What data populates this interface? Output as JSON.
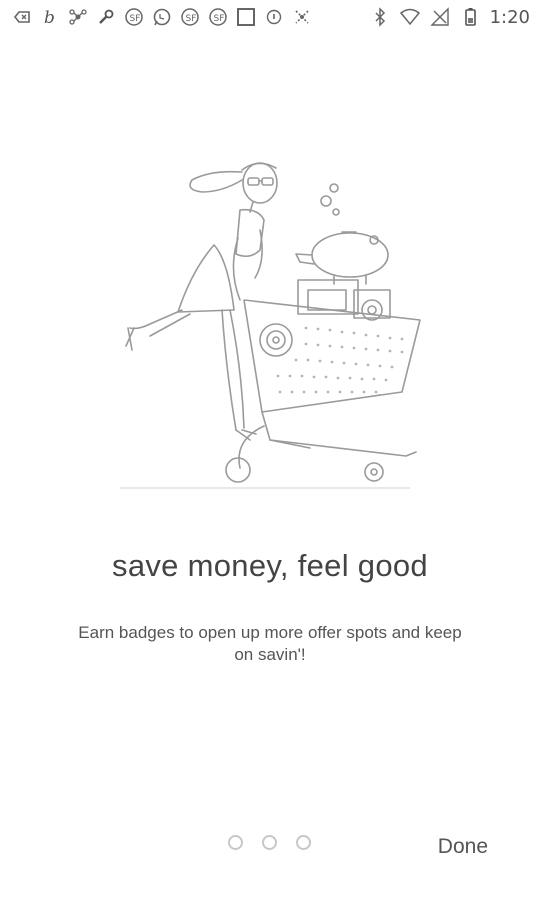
{
  "status_bar": {
    "time": "1:20",
    "left_icons": [
      "keyboard-back-icon",
      "b-app-icon",
      "drone-icon",
      "wrench-icon",
      "app-badge-icon",
      "whatsapp-icon",
      "app-badge-icon",
      "app-badge-icon",
      "square-icon",
      "info-circle-icon",
      "sparkle-icon"
    ],
    "right_icons": [
      "bluetooth-icon",
      "wifi-icon",
      "no-signal-icon",
      "battery-icon"
    ]
  },
  "onboarding": {
    "title": "save money, feel good",
    "description": "Earn badges to open up more offer spots and keep on savin'!",
    "pager": {
      "total": 3,
      "current": 0
    },
    "done_label": "Done"
  },
  "colors": {
    "accent": "#c0c0c0",
    "text": "#444444"
  }
}
